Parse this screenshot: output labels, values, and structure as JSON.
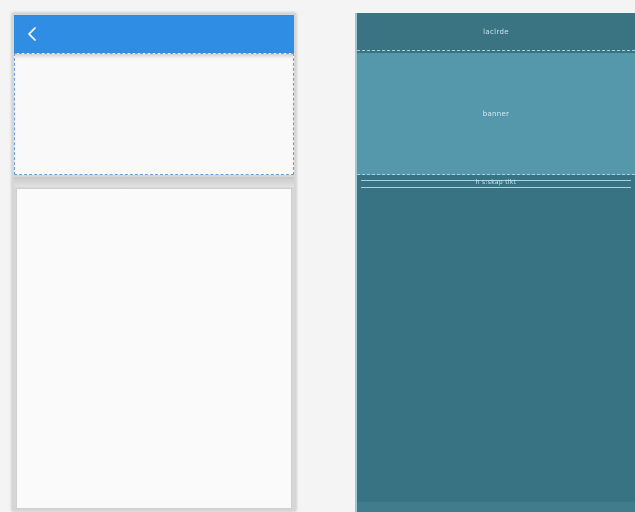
{
  "left_preview": {
    "appbar": {
      "back_icon": "chevron-left-icon",
      "color": "#2f8de4"
    }
  },
  "blueprint": {
    "header_label": "laclrde",
    "banner_label": "banner",
    "tabstrip_label": "h s:skap tlkt",
    "colors": {
      "background": "#377383",
      "banner": "#5698ab",
      "outline": "#a9d2de"
    }
  }
}
